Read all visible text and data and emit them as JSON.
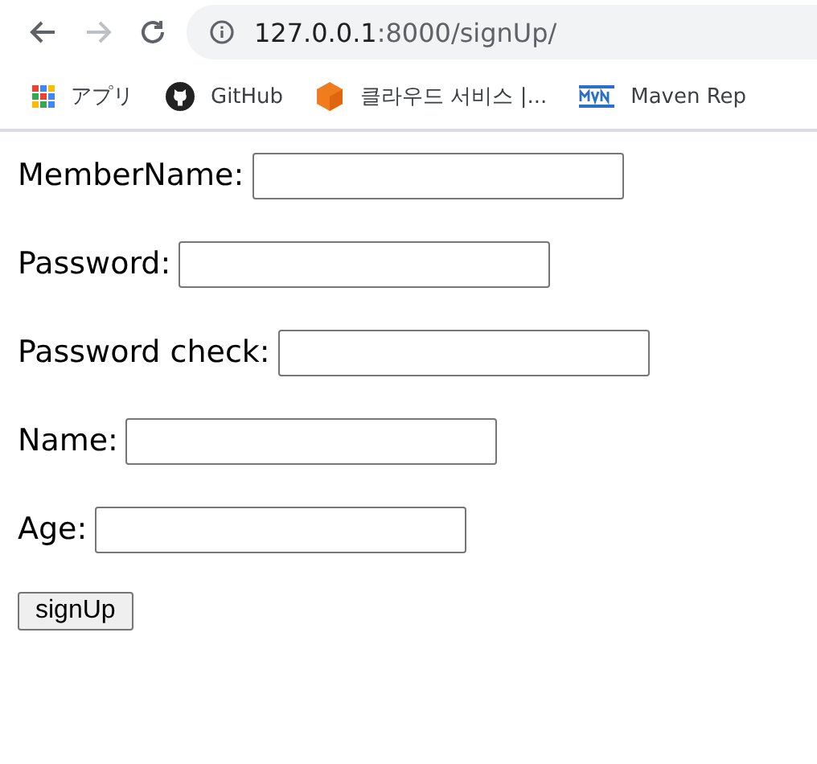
{
  "toolbar": {
    "buttons": [
      {
        "kind": "back",
        "disabled": false
      },
      {
        "kind": "forward",
        "disabled": true
      },
      {
        "kind": "reload",
        "disabled": false
      }
    ],
    "address": {
      "host": "127.0.0.1",
      "path": ":8000/signUp/"
    }
  },
  "bookmarks": [
    {
      "kind": "apps",
      "label": "アプリ"
    },
    {
      "kind": "github",
      "label": "GitHub"
    },
    {
      "kind": "cube",
      "label": "클라우드 서비스 |..."
    },
    {
      "kind": "maven",
      "label": "Maven Rep"
    }
  ],
  "form": {
    "fields": [
      {
        "label": "MemberName:"
      },
      {
        "label": "Password:"
      },
      {
        "label": "Password check:"
      },
      {
        "label": "Name:"
      },
      {
        "label": "Age:"
      }
    ],
    "submit": "signUp"
  }
}
